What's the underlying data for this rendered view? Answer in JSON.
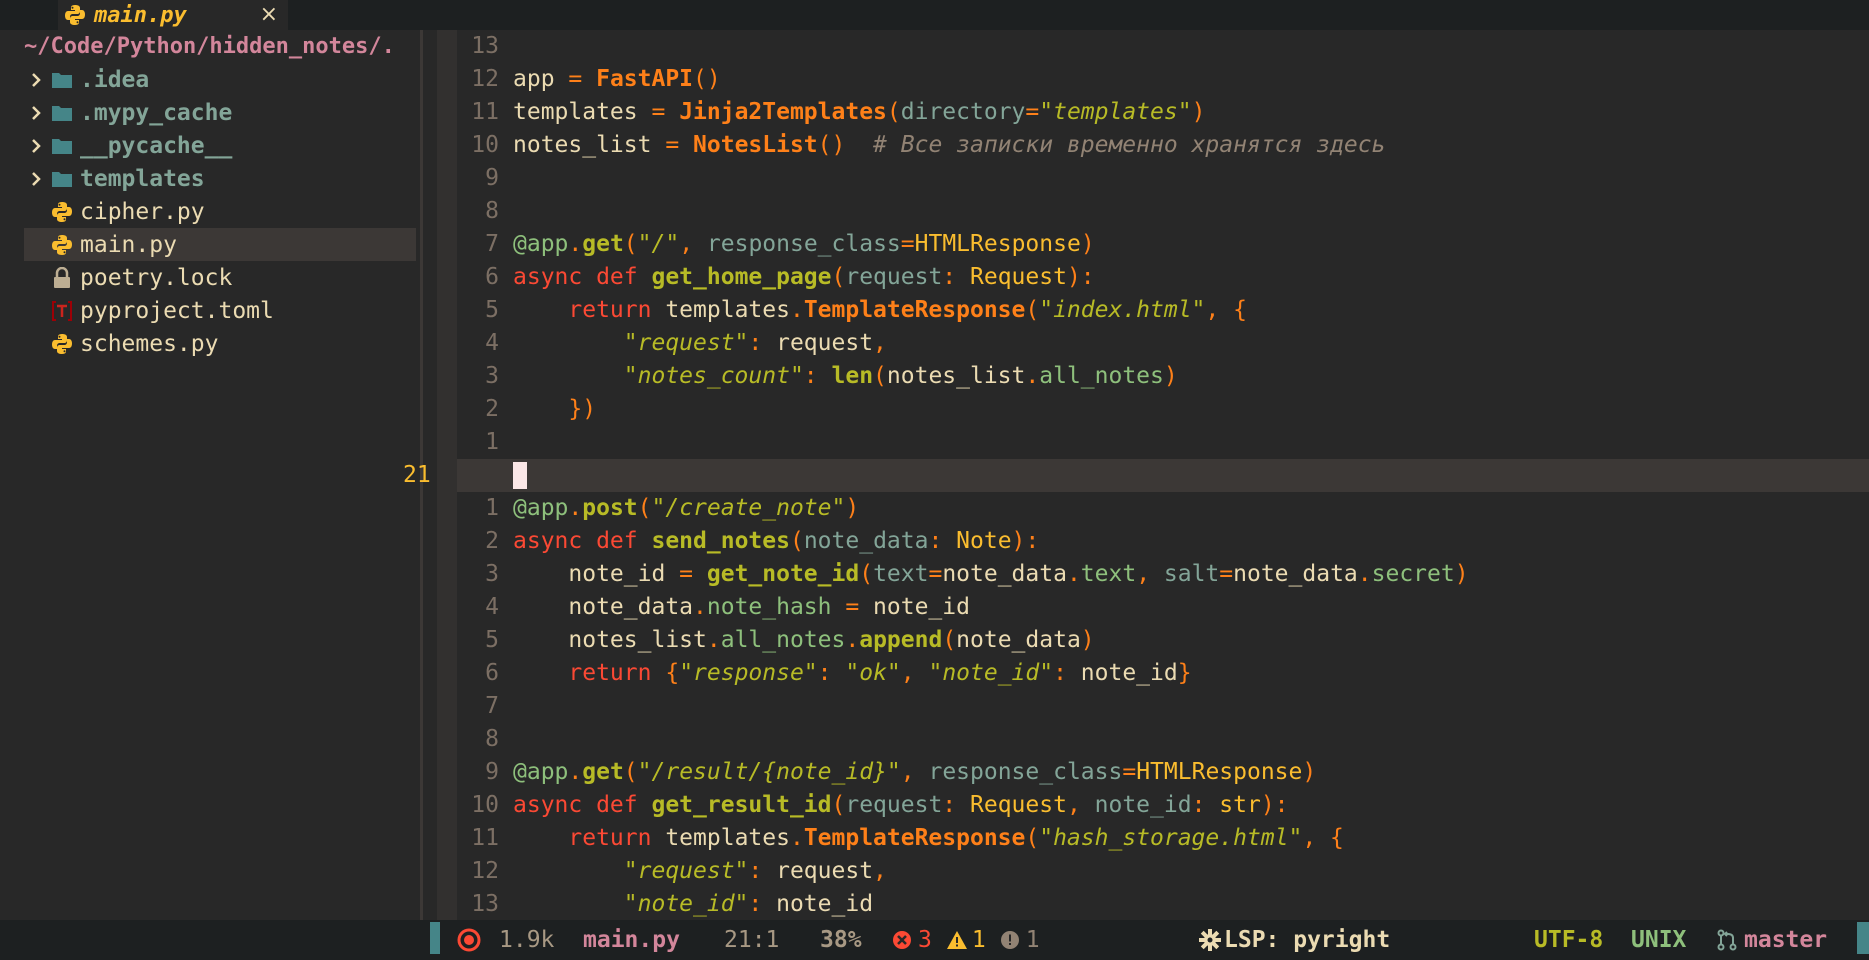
{
  "tab": {
    "title": "main.py",
    "close": "×",
    "icon": "python-icon"
  },
  "sidebar": {
    "path": "~/Code/Python/hidden_notes/.",
    "items": [
      {
        "label": ".idea",
        "kind": "folder"
      },
      {
        "label": ".mypy_cache",
        "kind": "folder"
      },
      {
        "label": "__pycache__",
        "kind": "folder"
      },
      {
        "label": "templates",
        "kind": "folder"
      },
      {
        "label": "cipher.py",
        "kind": "python"
      },
      {
        "label": "main.py",
        "kind": "python",
        "selected": true
      },
      {
        "label": "poetry.lock",
        "kind": "lock"
      },
      {
        "label": "pyproject.toml",
        "kind": "toml"
      },
      {
        "label": "schemes.py",
        "kind": "python"
      }
    ]
  },
  "editor": {
    "current_line": "21",
    "lines": [
      {
        "n": "13",
        "tokens": []
      },
      {
        "n": "12",
        "tokens": [
          [
            "app ",
            ""
          ],
          [
            "= ",
            "op"
          ],
          [
            "FastAPI",
            "cl"
          ],
          [
            "()",
            "op"
          ]
        ]
      },
      {
        "n": "11",
        "tokens": [
          [
            "templates ",
            ""
          ],
          [
            "= ",
            "op"
          ],
          [
            "Jinja2Templates",
            "cl"
          ],
          [
            "(",
            "op"
          ],
          [
            "directory",
            "pr"
          ],
          [
            "=",
            "op"
          ],
          [
            "\"templates\"",
            "st"
          ],
          [
            ")",
            "op"
          ]
        ]
      },
      {
        "n": "10",
        "tokens": [
          [
            "notes_list ",
            ""
          ],
          [
            "= ",
            "op"
          ],
          [
            "NotesList",
            "cl"
          ],
          [
            "()",
            "op"
          ],
          [
            "  # Все записки временно хранятся здесь",
            "cm"
          ]
        ]
      },
      {
        "n": "9",
        "tokens": []
      },
      {
        "n": "8",
        "tokens": []
      },
      {
        "n": "7",
        "tokens": [
          [
            "@app",
            "at"
          ],
          [
            ".",
            "op"
          ],
          [
            "get",
            "fn"
          ],
          [
            "(",
            "op"
          ],
          [
            "\"/\"",
            "st"
          ],
          [
            ", ",
            "op"
          ],
          [
            "response_class",
            "pr"
          ],
          [
            "=",
            "op"
          ],
          [
            "HTMLResponse",
            "ty"
          ],
          [
            ")",
            "op"
          ]
        ]
      },
      {
        "n": "6",
        "tokens": [
          [
            "async def ",
            "kw"
          ],
          [
            "get_home_page",
            "fn"
          ],
          [
            "(",
            "op"
          ],
          [
            "request",
            "pr"
          ],
          [
            ": ",
            "op"
          ],
          [
            "Request",
            "ty"
          ],
          [
            "):",
            "op"
          ]
        ]
      },
      {
        "n": "5",
        "tokens": [
          [
            "    return ",
            "kw"
          ],
          [
            "templates",
            ""
          ],
          [
            ".",
            "op"
          ],
          [
            "TemplateResponse",
            "cl"
          ],
          [
            "(",
            "op"
          ],
          [
            "\"index.html\"",
            "st"
          ],
          [
            ", {",
            "op"
          ]
        ]
      },
      {
        "n": "4",
        "tokens": [
          [
            "        \"request\"",
            "st"
          ],
          [
            ": ",
            "op"
          ],
          [
            "request",
            ""
          ],
          [
            ",",
            "op"
          ]
        ]
      },
      {
        "n": "3",
        "tokens": [
          [
            "        \"notes_count\"",
            "st"
          ],
          [
            ": ",
            "op"
          ],
          [
            "len",
            "fn"
          ],
          [
            "(",
            "op"
          ],
          [
            "notes_list",
            ""
          ],
          [
            ".",
            "op"
          ],
          [
            "all_notes",
            "dc"
          ],
          [
            ")",
            "op"
          ]
        ]
      },
      {
        "n": "2",
        "tokens": [
          [
            "    })",
            "op"
          ]
        ]
      },
      {
        "n": "1",
        "tokens": []
      },
      {
        "n": "21",
        "tokens": [],
        "current": true
      },
      {
        "n": "1",
        "tokens": [
          [
            "@app",
            "at"
          ],
          [
            ".",
            "op"
          ],
          [
            "post",
            "fn"
          ],
          [
            "(",
            "op"
          ],
          [
            "\"/create_note\"",
            "st"
          ],
          [
            ")",
            "op"
          ]
        ]
      },
      {
        "n": "2",
        "tokens": [
          [
            "async def ",
            "kw"
          ],
          [
            "send_notes",
            "fn"
          ],
          [
            "(",
            "op"
          ],
          [
            "note_data",
            "pr"
          ],
          [
            ": ",
            "op"
          ],
          [
            "Note",
            "ty"
          ],
          [
            "):",
            "op"
          ]
        ]
      },
      {
        "n": "3",
        "tokens": [
          [
            "    note_id ",
            ""
          ],
          [
            "= ",
            "op"
          ],
          [
            "get_note_id",
            "fn"
          ],
          [
            "(",
            "op"
          ],
          [
            "text",
            "pr"
          ],
          [
            "=",
            "op"
          ],
          [
            "note_data",
            ""
          ],
          [
            ".",
            "op"
          ],
          [
            "text",
            "dc"
          ],
          [
            ", ",
            "op"
          ],
          [
            "salt",
            "pr"
          ],
          [
            "=",
            "op"
          ],
          [
            "note_data",
            ""
          ],
          [
            ".",
            "op"
          ],
          [
            "secret",
            "dc"
          ],
          [
            ")",
            "op"
          ]
        ]
      },
      {
        "n": "4",
        "tokens": [
          [
            "    note_data",
            ""
          ],
          [
            ".",
            "op"
          ],
          [
            "note_hash",
            "dc"
          ],
          [
            " = ",
            "op"
          ],
          [
            "note_id",
            ""
          ]
        ]
      },
      {
        "n": "5",
        "tokens": [
          [
            "    notes_list",
            ""
          ],
          [
            ".",
            "op"
          ],
          [
            "all_notes",
            "dc"
          ],
          [
            ".",
            "op"
          ],
          [
            "append",
            "fn"
          ],
          [
            "(",
            "op"
          ],
          [
            "note_data",
            ""
          ],
          [
            ")",
            "op"
          ]
        ]
      },
      {
        "n": "6",
        "tokens": [
          [
            "    return ",
            "kw"
          ],
          [
            "{",
            "op"
          ],
          [
            "\"response\"",
            "st"
          ],
          [
            ": ",
            "op"
          ],
          [
            "\"ok\"",
            "st"
          ],
          [
            ", ",
            "op"
          ],
          [
            "\"note_id\"",
            "st"
          ],
          [
            ": ",
            "op"
          ],
          [
            "note_id",
            ""
          ],
          [
            "}",
            "op"
          ]
        ]
      },
      {
        "n": "7",
        "tokens": []
      },
      {
        "n": "8",
        "tokens": []
      },
      {
        "n": "9",
        "tokens": [
          [
            "@app",
            "at"
          ],
          [
            ".",
            "op"
          ],
          [
            "get",
            "fn"
          ],
          [
            "(",
            "op"
          ],
          [
            "\"/result/{note_id}\"",
            "st"
          ],
          [
            ", ",
            "op"
          ],
          [
            "response_class",
            "pr"
          ],
          [
            "=",
            "op"
          ],
          [
            "HTMLResponse",
            "ty"
          ],
          [
            ")",
            "op"
          ]
        ]
      },
      {
        "n": "10",
        "tokens": [
          [
            "async def ",
            "kw"
          ],
          [
            "get_result_id",
            "fn"
          ],
          [
            "(",
            "op"
          ],
          [
            "request",
            "pr"
          ],
          [
            ": ",
            "op"
          ],
          [
            "Request",
            "ty"
          ],
          [
            ", ",
            "op"
          ],
          [
            "note_id",
            "pr"
          ],
          [
            ": ",
            "op"
          ],
          [
            "str",
            "ty"
          ],
          [
            "):",
            "op"
          ]
        ]
      },
      {
        "n": "11",
        "tokens": [
          [
            "    return ",
            "kw"
          ],
          [
            "templates",
            ""
          ],
          [
            ".",
            "op"
          ],
          [
            "TemplateResponse",
            "cl"
          ],
          [
            "(",
            "op"
          ],
          [
            "\"hash_storage.html\"",
            "st"
          ],
          [
            ", {",
            "op"
          ]
        ]
      },
      {
        "n": "12",
        "tokens": [
          [
            "        \"request\"",
            "st"
          ],
          [
            ": ",
            "op"
          ],
          [
            "request",
            ""
          ],
          [
            ",",
            "op"
          ]
        ]
      },
      {
        "n": "13",
        "tokens": [
          [
            "        \"note_id\"",
            "st"
          ],
          [
            ": ",
            "op"
          ],
          [
            "note_id",
            ""
          ]
        ]
      }
    ]
  },
  "status": {
    "size": "1.9k",
    "file": "main.py",
    "position": "21:1",
    "percent": "38%",
    "errors": "3",
    "warnings": "1",
    "info": "1",
    "lsp": "LSP: pyright",
    "encoding": "UTF-8",
    "eol": "UNIX",
    "branch": "master"
  },
  "colors": {
    "bg": "#282828",
    "accent": "#458588",
    "folder": "#83a598"
  }
}
